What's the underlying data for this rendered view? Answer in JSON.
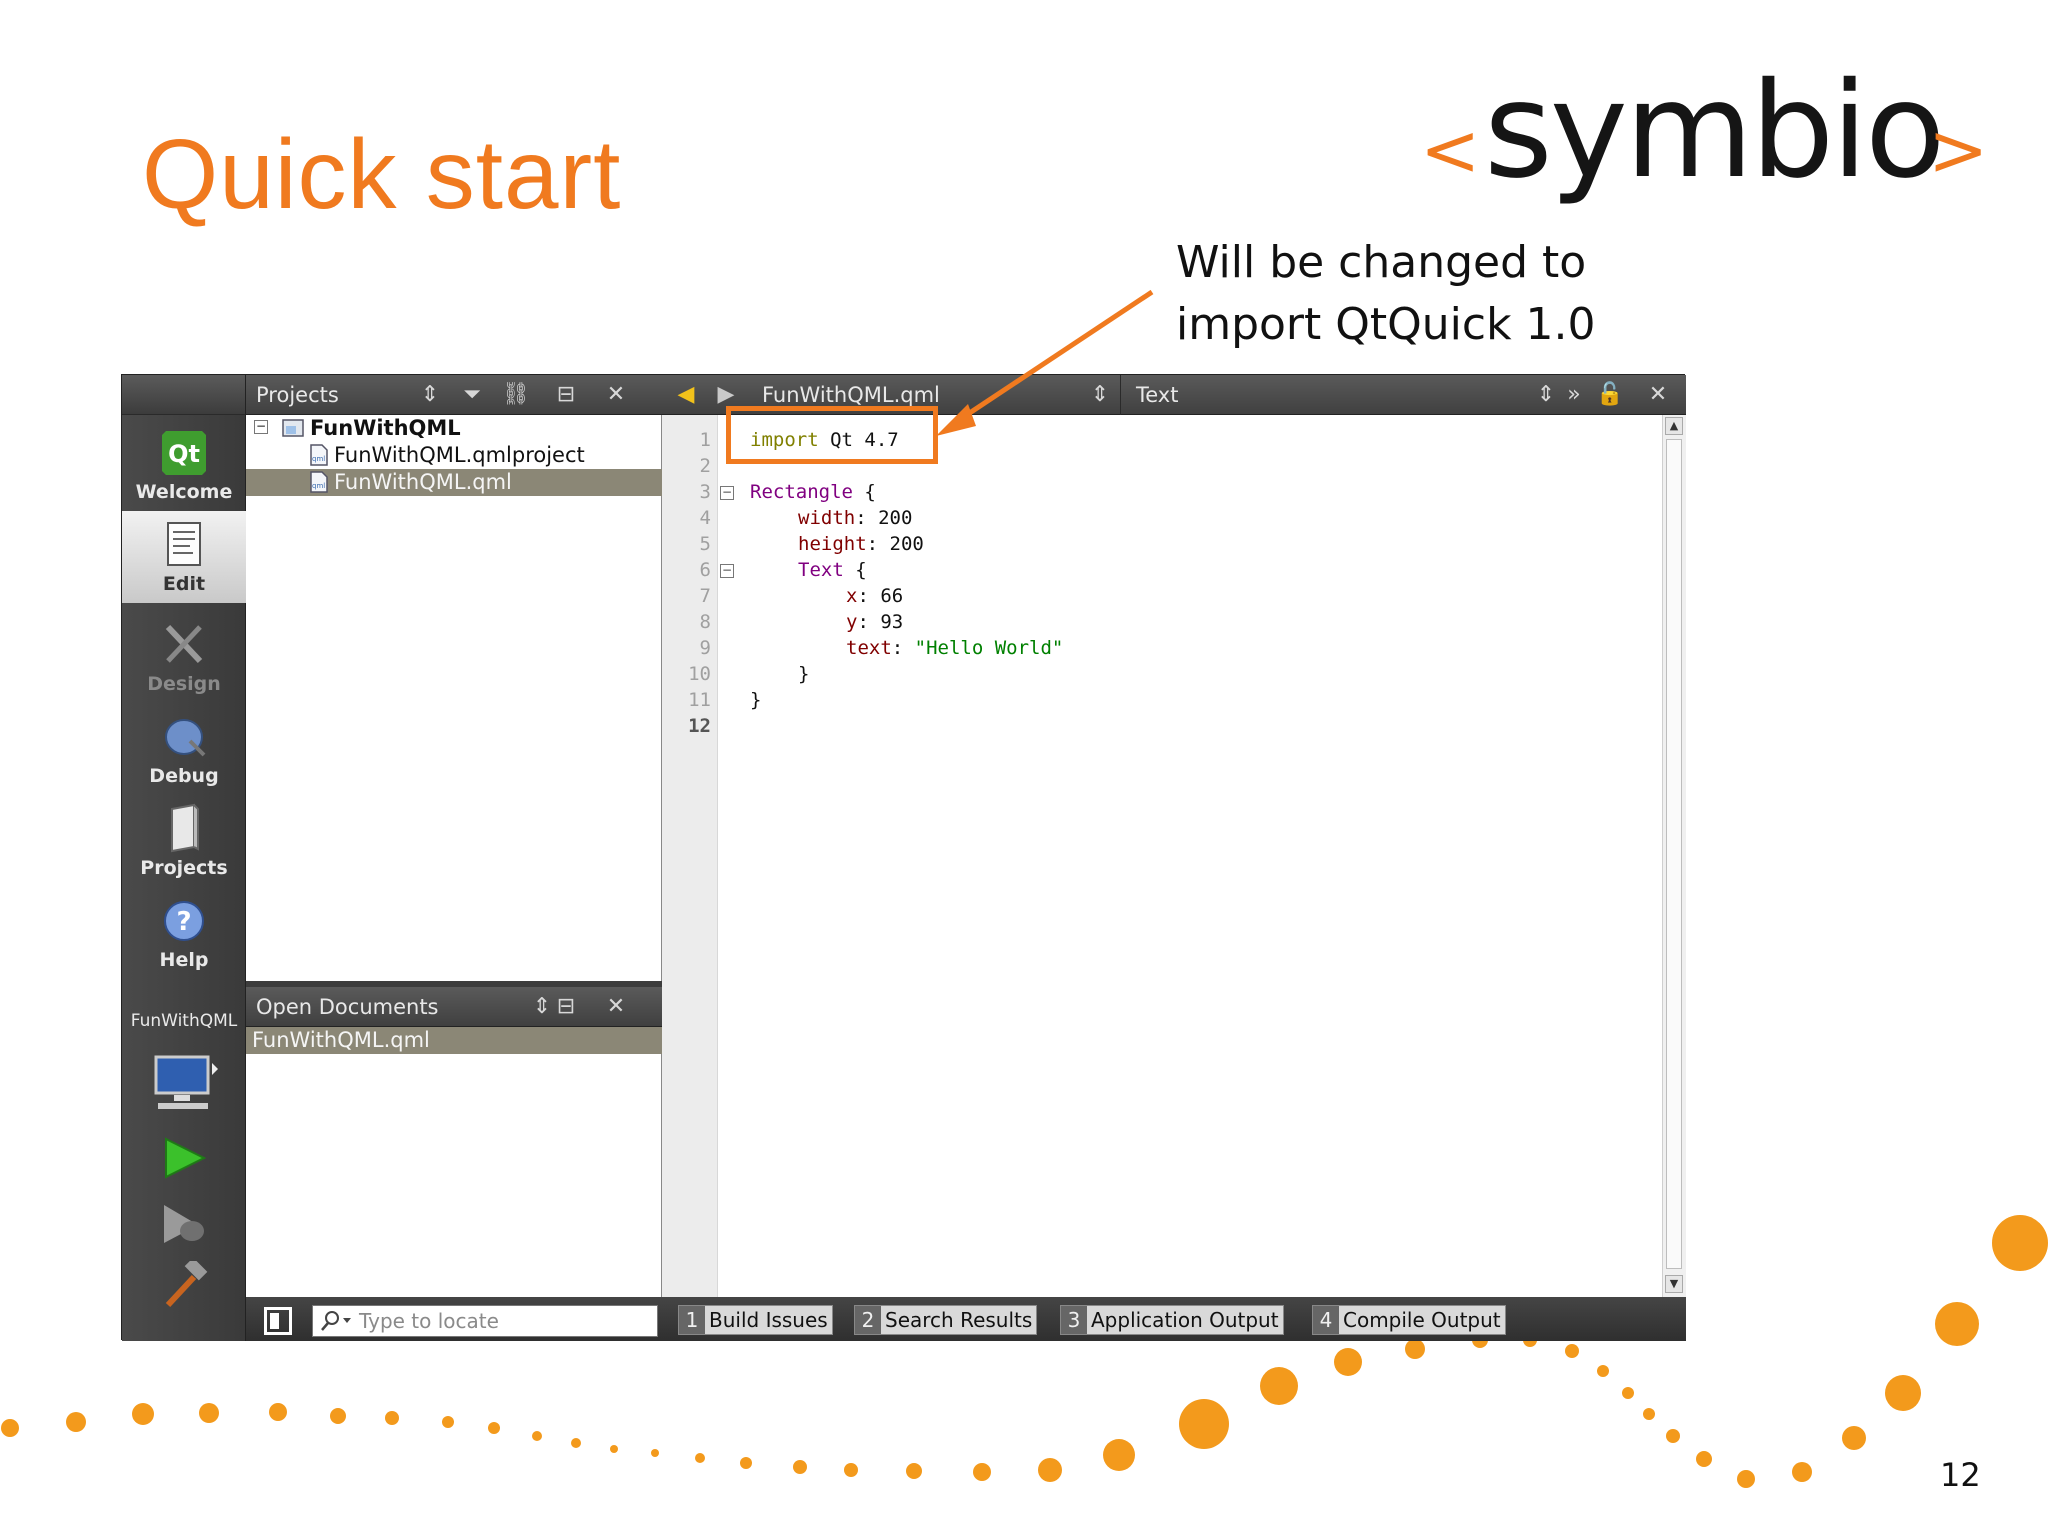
{
  "slide": {
    "title": "Quick start",
    "logo": {
      "left_bracket": "<",
      "word": "symbio",
      "right_bracket": ">"
    },
    "callout": {
      "line1": "Will be changed to",
      "line2": "import QtQuick 1.0"
    },
    "page_number": "12",
    "accent_color": "#f07a1f"
  },
  "ide": {
    "modes": [
      {
        "label": "Welcome",
        "icon": "qt-logo-icon",
        "state": "normal"
      },
      {
        "label": "Edit",
        "icon": "edit-document-icon",
        "state": "active"
      },
      {
        "label": "Design",
        "icon": "design-tools-icon",
        "state": "disabled"
      },
      {
        "label": "Debug",
        "icon": "debug-bug-icon",
        "state": "normal"
      },
      {
        "label": "Projects",
        "icon": "projects-book-icon",
        "state": "normal"
      },
      {
        "label": "Help",
        "icon": "help-question-icon",
        "state": "normal"
      }
    ],
    "target": {
      "project": "FunWithQML"
    },
    "projects_pane": {
      "title": "Projects",
      "tree": [
        {
          "label": "FunWithQML",
          "type": "project",
          "bold": true
        },
        {
          "label": "FunWithQML.qmlproject",
          "type": "qmlproject"
        },
        {
          "label": "FunWithQML.qml",
          "type": "qml",
          "selected": true
        }
      ]
    },
    "open_documents": {
      "title": "Open Documents",
      "items": [
        "FunWithQML.qml"
      ]
    },
    "editor": {
      "file": "FunWithQML.qml",
      "symbol": "Text",
      "line_numbers": [
        "1",
        "2",
        "3",
        "4",
        "5",
        "6",
        "7",
        "8",
        "9",
        "10",
        "11",
        "12"
      ],
      "code": {
        "l1": {
          "kw": "import",
          "rest": " Qt 4.7"
        },
        "l3": {
          "type": "Rectangle",
          "rest": " {"
        },
        "l4": {
          "prop": "width",
          "rest": ": 200"
        },
        "l5": {
          "prop": "height",
          "rest": ": 200"
        },
        "l6": {
          "type": "Text",
          "rest": " {"
        },
        "l7": {
          "prop": "x",
          "rest": ": 66"
        },
        "l8": {
          "prop": "y",
          "rest": ": 93"
        },
        "l9": {
          "prop": "text",
          "sep": ": ",
          "str": "\"Hello World\""
        },
        "l10": "}",
        "l11": "}"
      }
    },
    "status": {
      "locator_placeholder": "Type to locate",
      "output_tabs": [
        {
          "num": "1",
          "label": "Build Issues"
        },
        {
          "num": "2",
          "label": "Search Results"
        },
        {
          "num": "3",
          "label": "Application Output"
        },
        {
          "num": "4",
          "label": "Compile Output"
        }
      ]
    }
  }
}
